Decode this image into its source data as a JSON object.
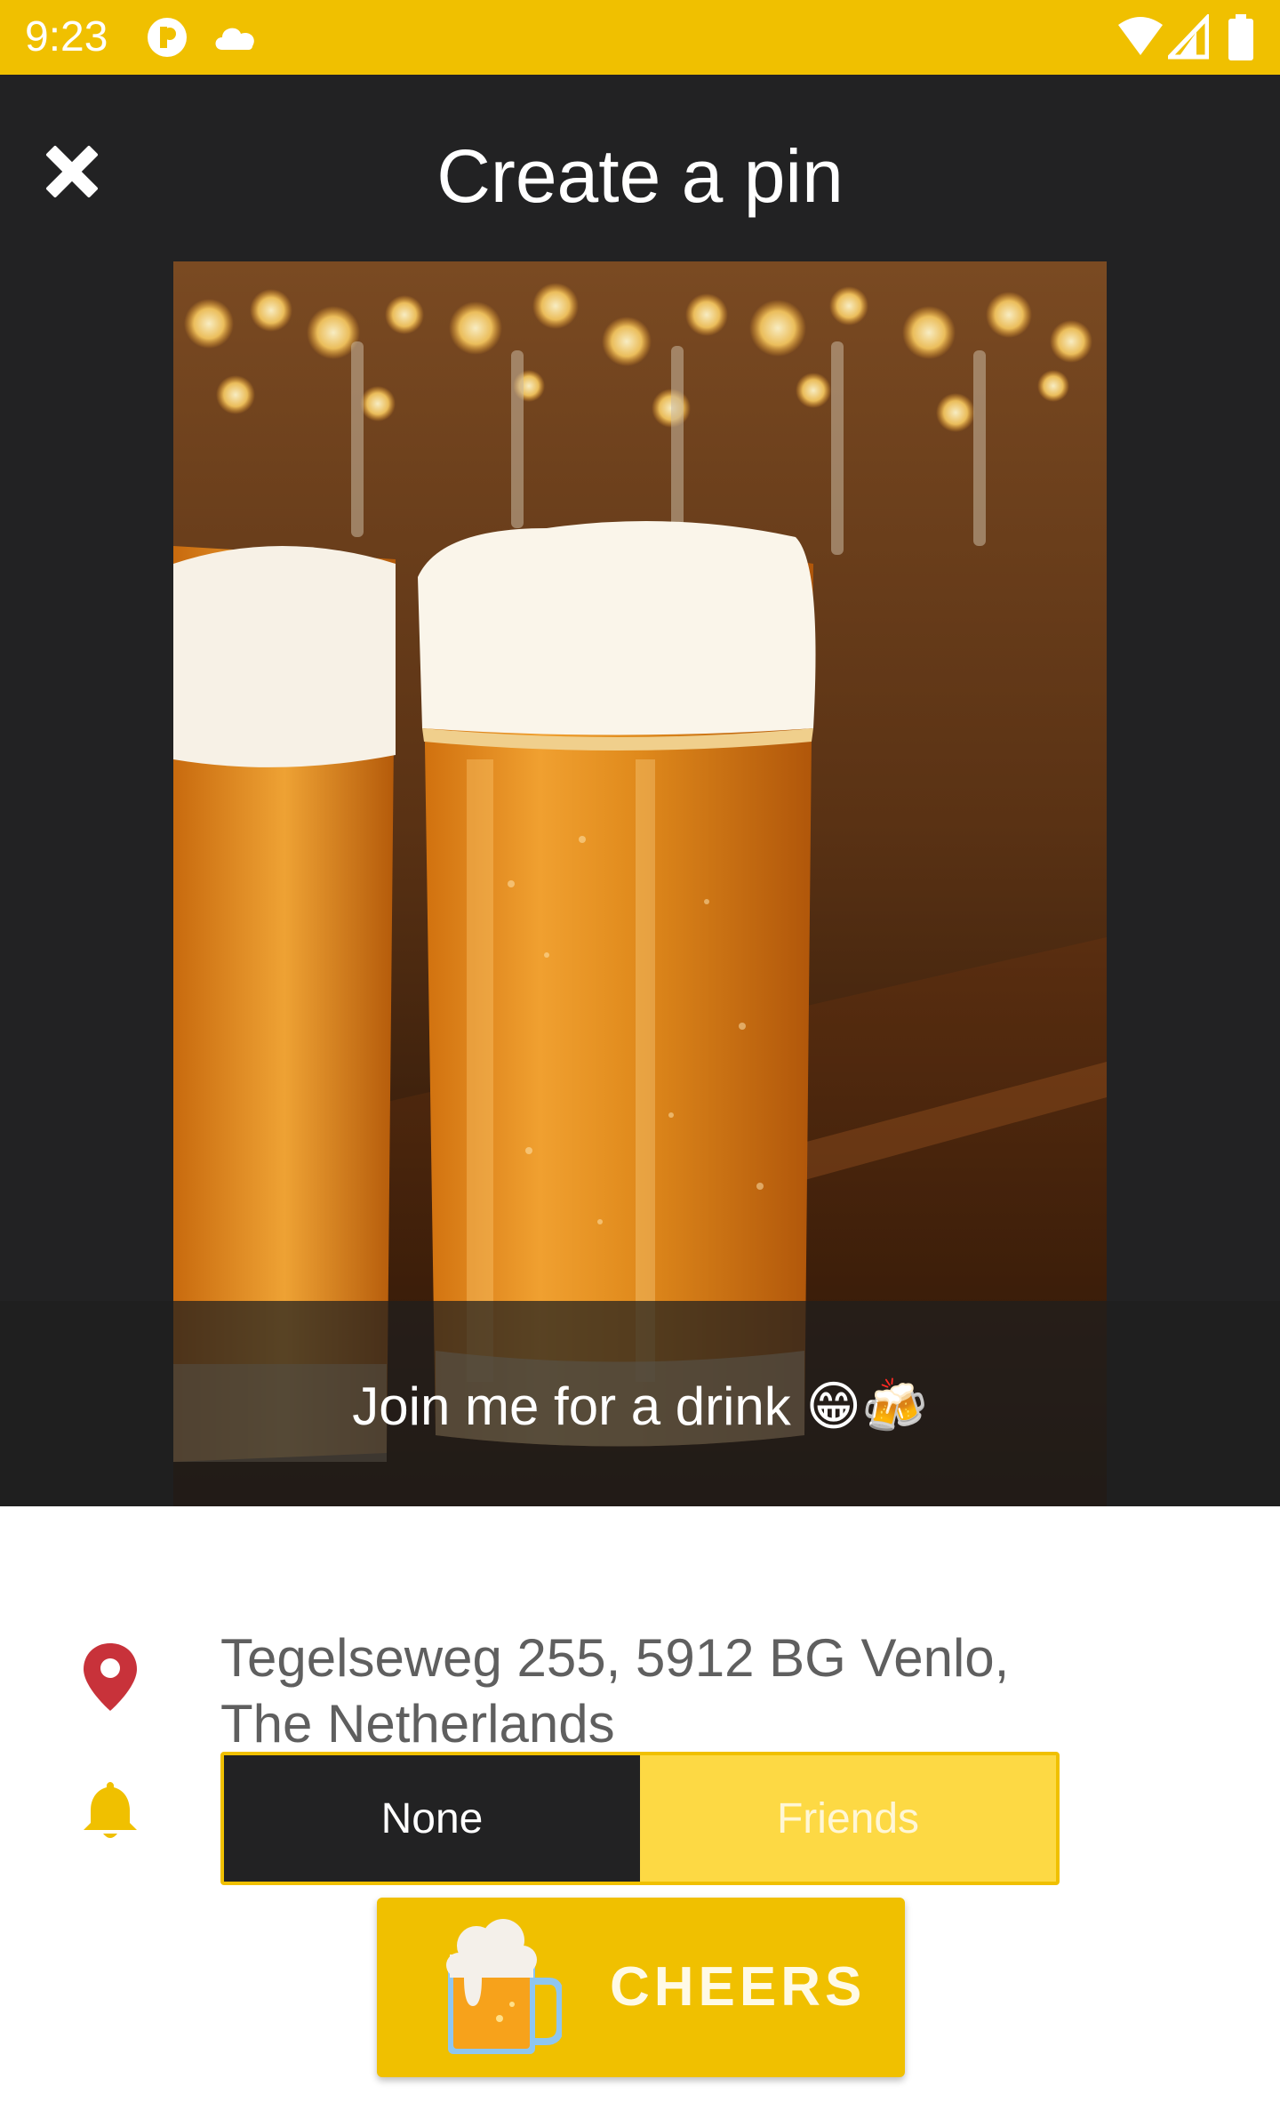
{
  "status_bar": {
    "time": "9:23",
    "icons": [
      "app-notification-icon",
      "cloud-icon",
      "wifi-icon",
      "signal-icon",
      "battery-icon"
    ]
  },
  "header": {
    "title": "Create a pin",
    "close_icon": "close-icon"
  },
  "pin": {
    "caption": "Join me for a drink 😁🍻",
    "photo": "photo of two pints of beer on a bar counter"
  },
  "form": {
    "location_icon": "location-pin-icon",
    "address_line1": "Tegelseweg 255, 5912 BG Venlo,",
    "address_line2": "The Netherlands",
    "notify_icon": "bell-icon",
    "visibility_options": [
      {
        "label": "None",
        "selected": true
      },
      {
        "label": "Friends",
        "selected": false
      }
    ]
  },
  "action": {
    "label": "CHEERS",
    "icon": "beer-mug-icon"
  },
  "colors": {
    "accent": "#f0c000",
    "dark": "#222223",
    "toggle_inactive": "#fdd944",
    "location_red": "#c8323a"
  }
}
